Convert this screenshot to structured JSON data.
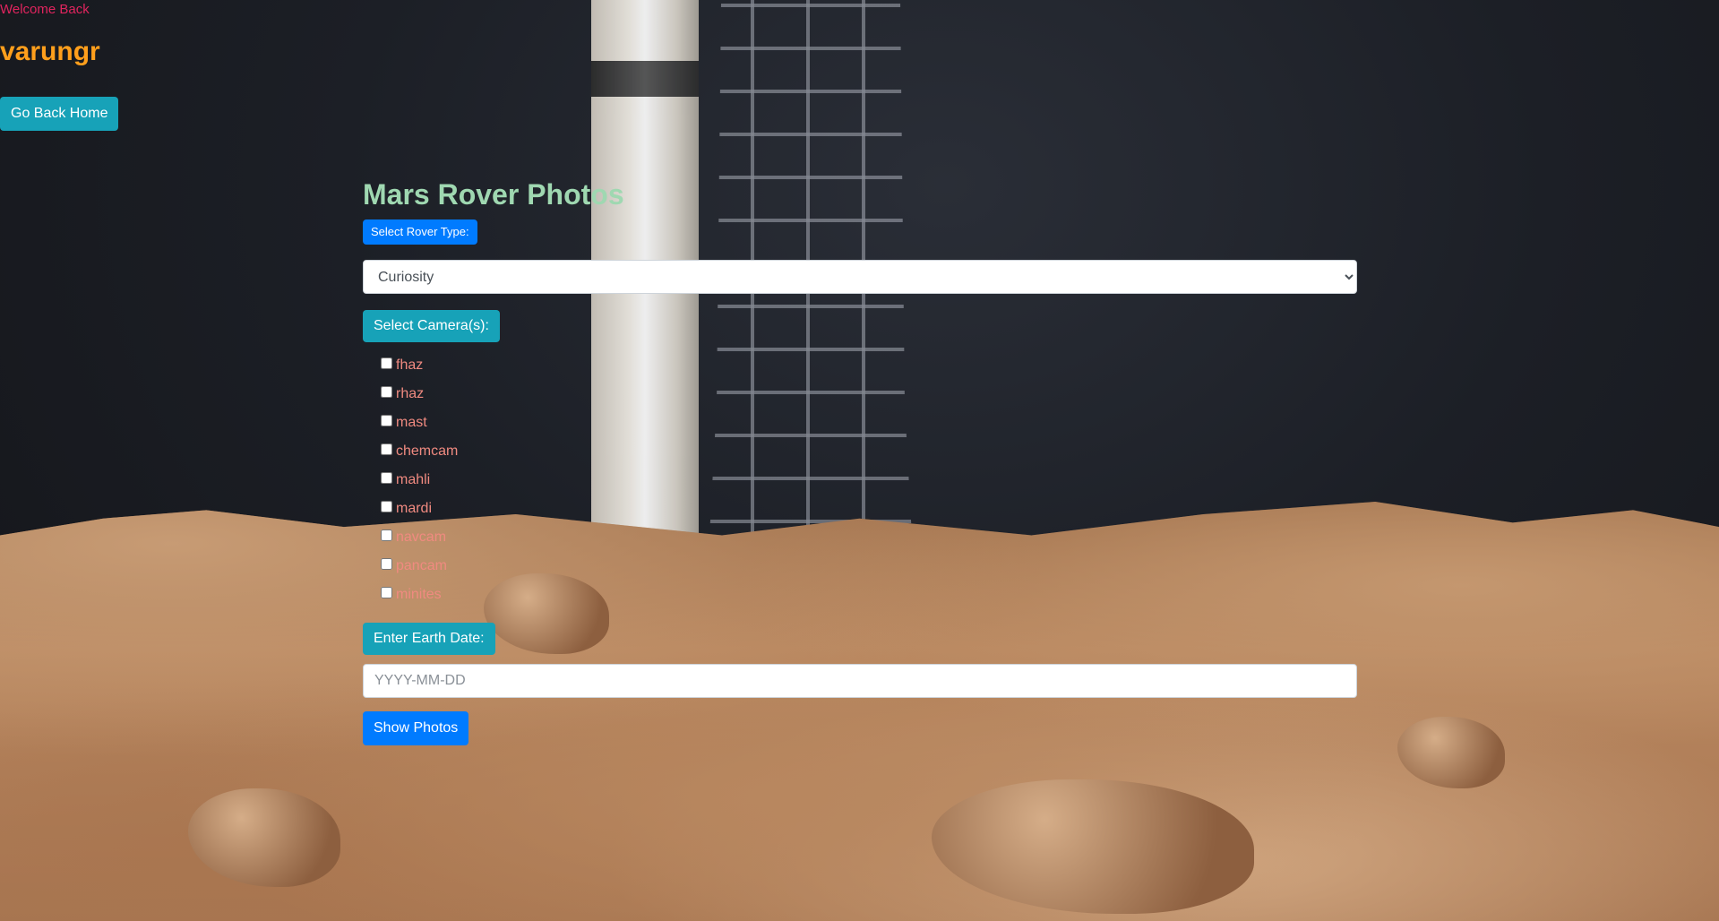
{
  "header": {
    "welcome_text": "Welcome Back",
    "username": "varungr",
    "home_button_label": "Go Back Home"
  },
  "form": {
    "title": "Mars Rover Photos",
    "rover_label": "Select Rover Type:",
    "rover_options": [
      "Curiosity"
    ],
    "rover_selected": "Curiosity",
    "camera_label": "Select Camera(s):",
    "cameras": [
      {
        "label": "fhaz",
        "checked": false
      },
      {
        "label": "rhaz",
        "checked": false
      },
      {
        "label": "mast",
        "checked": false
      },
      {
        "label": "chemcam",
        "checked": false
      },
      {
        "label": "mahli",
        "checked": false
      },
      {
        "label": "mardi",
        "checked": false
      },
      {
        "label": "navcam",
        "checked": false
      },
      {
        "label": "pancam",
        "checked": false
      },
      {
        "label": "minites",
        "checked": false
      }
    ],
    "date_label": "Enter Earth Date:",
    "date_placeholder": "YYYY-MM-DD",
    "date_value": "",
    "submit_label": "Show Photos"
  },
  "colors": {
    "welcome": "#e0245e",
    "username": "#ff9f1c",
    "title": "#9fd8b1",
    "camera_label_text": "#f08a80",
    "info_button": "#17a2b8",
    "primary_button": "#007bff"
  }
}
